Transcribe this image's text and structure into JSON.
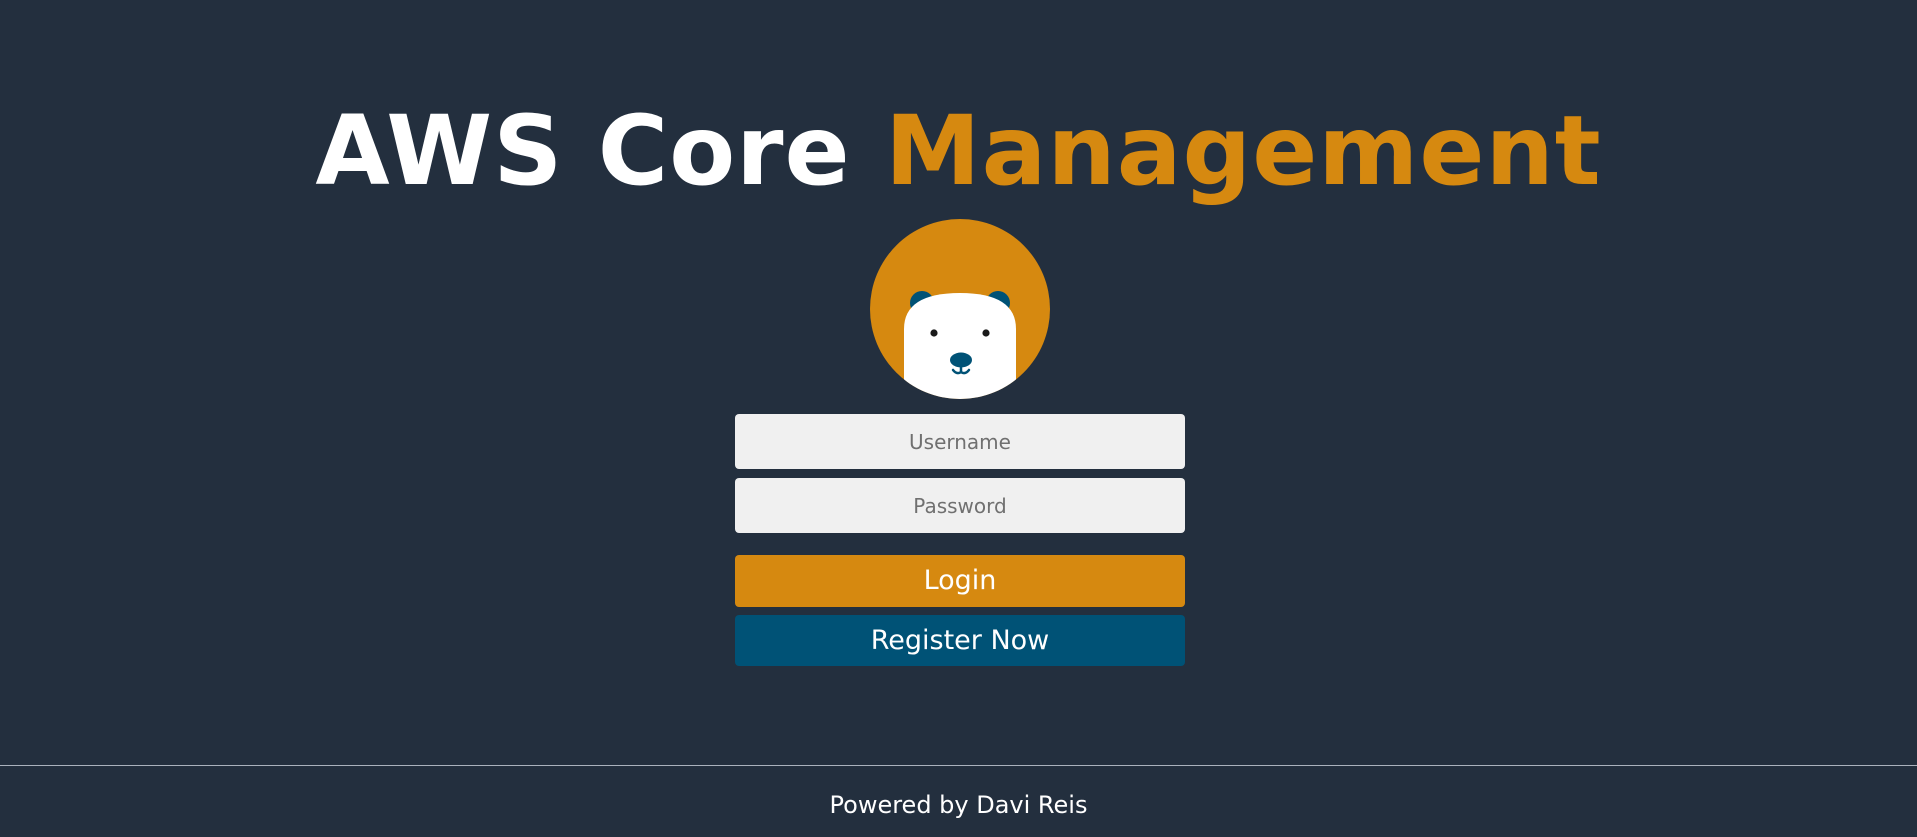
{
  "header": {
    "title_part1": "AWS Core",
    "title_part2": "Management"
  },
  "avatar": {
    "icon": "polar-bear-icon",
    "bg_color": "#d68910",
    "accent_color": "#005276"
  },
  "login_form": {
    "username_placeholder": "Username",
    "password_placeholder": "Password",
    "login_label": "Login",
    "register_label": "Register Now"
  },
  "footer": {
    "text": "Powered by Davi Reis"
  },
  "colors": {
    "background": "#232f3e",
    "accent_orange": "#d68910",
    "accent_blue": "#005276",
    "field_bg": "#f0f0f0"
  }
}
